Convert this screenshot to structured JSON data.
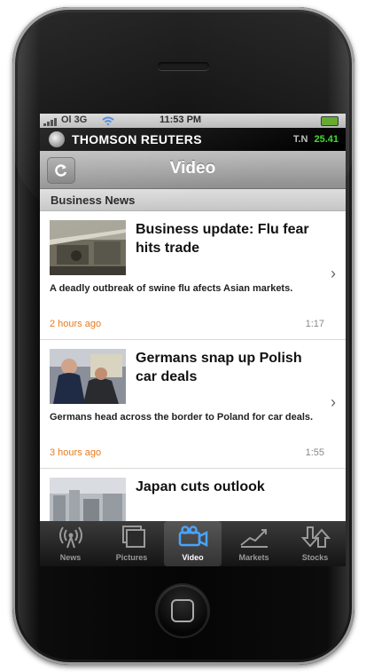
{
  "status_bar": {
    "carrier": "Ol 3G",
    "time": "11:53 PM"
  },
  "brand": {
    "name": "THOMSON REUTERS",
    "ticker_symbol": "T.N",
    "ticker_value": "25.41"
  },
  "nav": {
    "title": "Video",
    "refresh_icon": "refresh-icon"
  },
  "section": {
    "title": "Business News"
  },
  "stories": [
    {
      "headline": "Business update: Flu fear hits trade",
      "summary": "A deadly outbreak of swine flu afects Asian markets.",
      "age": "2 hours ago",
      "duration": "1:17"
    },
    {
      "headline": "Germans snap up Polish car deals",
      "summary": "Germans head across the border to Poland for car deals.",
      "age": "3 hours ago",
      "duration": "1:55"
    },
    {
      "headline": "Japan cuts outlook",
      "summary": "",
      "age": "",
      "duration": ""
    }
  ],
  "tabs": [
    {
      "label": "News",
      "icon": "radio-antenna-icon"
    },
    {
      "label": "Pictures",
      "icon": "pictures-icon"
    },
    {
      "label": "Video",
      "icon": "video-camera-icon",
      "active": true
    },
    {
      "label": "Markets",
      "icon": "markets-chart-icon"
    },
    {
      "label": "Stocks",
      "icon": "stocks-arrows-icon"
    }
  ],
  "colors": {
    "ticker_up": "#3ddc2a",
    "age_text": "#ea7a1a",
    "brand_bar": "#000000"
  }
}
